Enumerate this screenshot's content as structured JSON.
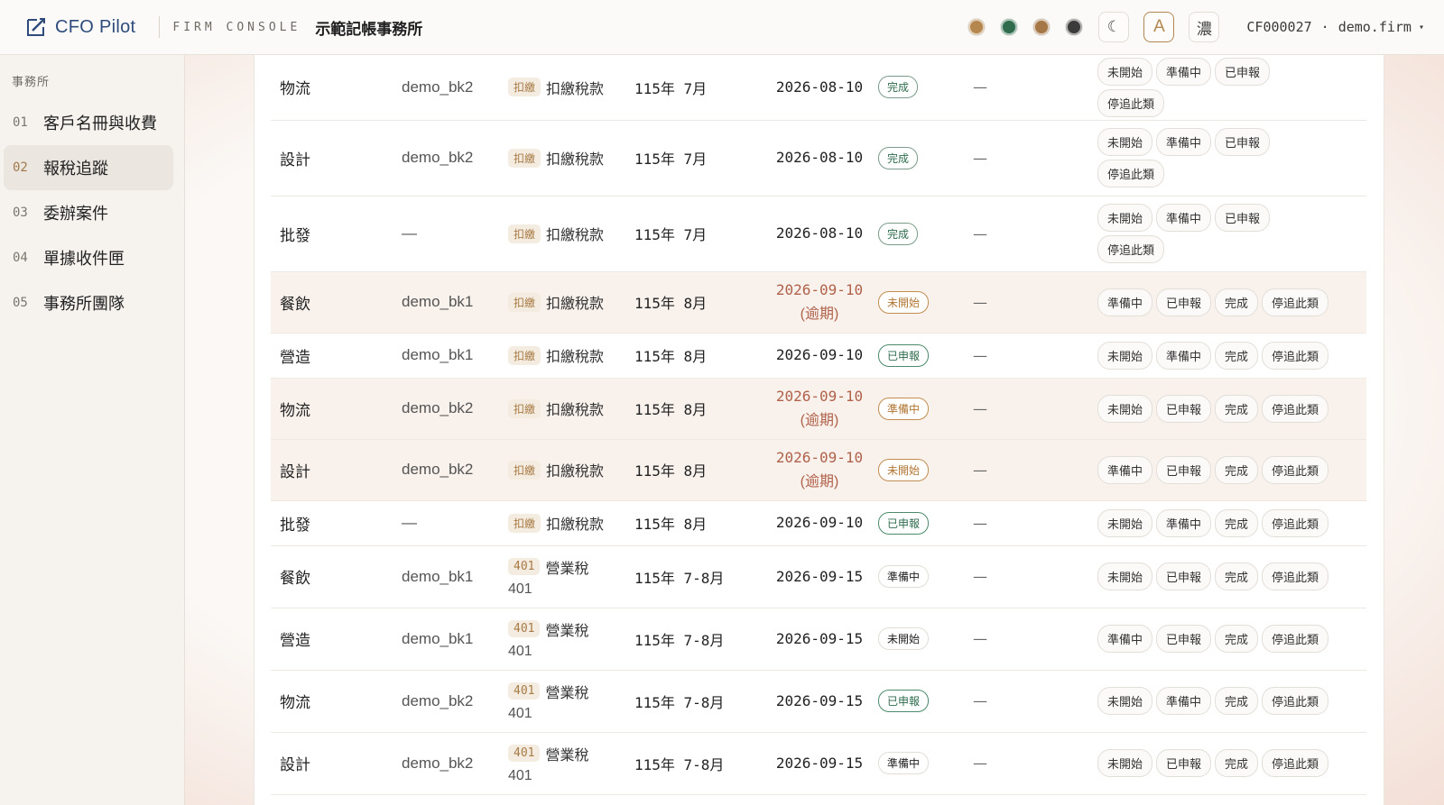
{
  "brand": {
    "name": "CFO Pilot",
    "console_label": "FIRM CONSOLE",
    "firm_name": "示範記帳事務所"
  },
  "theme_swatches": [
    "#b5874f",
    "#2f6b4c",
    "#a57646",
    "#3b3b3b"
  ],
  "toolbar": {
    "dark_toggle": "☾",
    "font_button": "A",
    "density_button": "濃"
  },
  "account": {
    "id": "CF000027",
    "separator": "·",
    "firm": "demo.firm",
    "caret": "▾"
  },
  "sidebar": {
    "title": "事務所",
    "items": [
      {
        "num": "01",
        "label": "客戶名冊與收費"
      },
      {
        "num": "02",
        "label": "報稅追蹤",
        "active": true
      },
      {
        "num": "03",
        "label": "委辦案件"
      },
      {
        "num": "04",
        "label": "單據收件匣"
      },
      {
        "num": "05",
        "label": "事務所團隊"
      }
    ]
  },
  "rows": [
    {
      "industry": "物流",
      "bookkeeper": "demo_bk2",
      "tax_tag": "扣繳",
      "tax_name": "扣繳稅款",
      "tax_code": "",
      "period": "115年 7月",
      "due": "2026-08-10",
      "overdue": false,
      "overdue_label": "",
      "status": "完成",
      "status_style": "done",
      "note": "—",
      "actions": [
        "未開始",
        "準備中",
        "已申報",
        "停追此類"
      ],
      "wrap": true,
      "h": 72
    },
    {
      "industry": "設計",
      "bookkeeper": "demo_bk2",
      "tax_tag": "扣繳",
      "tax_name": "扣繳稅款",
      "tax_code": "",
      "period": "115年 7月",
      "due": "2026-08-10",
      "overdue": false,
      "overdue_label": "",
      "status": "完成",
      "status_style": "done",
      "note": "—",
      "actions": [
        "未開始",
        "準備中",
        "已申報",
        "停追此類"
      ],
      "wrap": true,
      "h": 84
    },
    {
      "industry": "批發",
      "bookkeeper": "—",
      "tax_tag": "扣繳",
      "tax_name": "扣繳稅款",
      "tax_code": "",
      "period": "115年 7月",
      "due": "2026-08-10",
      "overdue": false,
      "overdue_label": "",
      "status": "完成",
      "status_style": "done",
      "note": "—",
      "actions": [
        "未開始",
        "準備中",
        "已申報",
        "停追此類"
      ],
      "wrap": true,
      "h": 84
    },
    {
      "industry": "餐飲",
      "bookkeeper": "demo_bk1",
      "tax_tag": "扣繳",
      "tax_name": "扣繳稅款",
      "tax_code": "",
      "period": "115年 8月",
      "due": "2026-09-10",
      "overdue": true,
      "overdue_label": "(逾期)",
      "status": "未開始",
      "status_style": "warn",
      "note": "—",
      "actions": [
        "準備中",
        "已申報",
        "完成",
        "停追此類"
      ],
      "wrap": false,
      "h": 68
    },
    {
      "industry": "營造",
      "bookkeeper": "demo_bk1",
      "tax_tag": "扣繳",
      "tax_name": "扣繳稅款",
      "tax_code": "",
      "period": "115年 8月",
      "due": "2026-09-10",
      "overdue": false,
      "overdue_label": "",
      "status": "已申報",
      "status_style": "filed",
      "note": "—",
      "actions": [
        "未開始",
        "準備中",
        "完成",
        "停追此類"
      ],
      "wrap": false,
      "h": 50
    },
    {
      "industry": "物流",
      "bookkeeper": "demo_bk2",
      "tax_tag": "扣繳",
      "tax_name": "扣繳稅款",
      "tax_code": "",
      "period": "115年 8月",
      "due": "2026-09-10",
      "overdue": true,
      "overdue_label": "(逾期)",
      "status": "準備中",
      "status_style": "warn",
      "note": "—",
      "actions": [
        "未開始",
        "已申報",
        "完成",
        "停追此類"
      ],
      "wrap": false,
      "h": 68
    },
    {
      "industry": "設計",
      "bookkeeper": "demo_bk2",
      "tax_tag": "扣繳",
      "tax_name": "扣繳稅款",
      "tax_code": "",
      "period": "115年 8月",
      "due": "2026-09-10",
      "overdue": true,
      "overdue_label": "(逾期)",
      "status": "未開始",
      "status_style": "warn",
      "note": "—",
      "actions": [
        "準備中",
        "已申報",
        "完成",
        "停追此類"
      ],
      "wrap": false,
      "h": 68
    },
    {
      "industry": "批發",
      "bookkeeper": "—",
      "tax_tag": "扣繳",
      "tax_name": "扣繳稅款",
      "tax_code": "",
      "period": "115年 8月",
      "due": "2026-09-10",
      "overdue": false,
      "overdue_label": "",
      "status": "已申報",
      "status_style": "filed",
      "note": "—",
      "actions": [
        "未開始",
        "準備中",
        "完成",
        "停追此類"
      ],
      "wrap": false,
      "h": 50
    },
    {
      "industry": "餐飲",
      "bookkeeper": "demo_bk1",
      "tax_tag": "401",
      "tax_name": "營業稅",
      "tax_code": "401",
      "period": "115年 7-8月",
      "due": "2026-09-15",
      "overdue": false,
      "overdue_label": "",
      "status": "準備中",
      "status_style": "plain",
      "note": "—",
      "actions": [
        "未開始",
        "已申報",
        "完成",
        "停追此類"
      ],
      "wrap": false,
      "h": 69
    },
    {
      "industry": "營造",
      "bookkeeper": "demo_bk1",
      "tax_tag": "401",
      "tax_name": "營業稅",
      "tax_code": "401",
      "period": "115年 7-8月",
      "due": "2026-09-15",
      "overdue": false,
      "overdue_label": "",
      "status": "未開始",
      "status_style": "plain",
      "note": "—",
      "actions": [
        "準備中",
        "已申報",
        "完成",
        "停追此類"
      ],
      "wrap": false,
      "h": 69
    },
    {
      "industry": "物流",
      "bookkeeper": "demo_bk2",
      "tax_tag": "401",
      "tax_name": "營業稅",
      "tax_code": "401",
      "period": "115年 7-8月",
      "due": "2026-09-15",
      "overdue": false,
      "overdue_label": "",
      "status": "已申報",
      "status_style": "filed",
      "note": "—",
      "actions": [
        "未開始",
        "準備中",
        "完成",
        "停追此類"
      ],
      "wrap": false,
      "h": 69
    },
    {
      "industry": "設計",
      "bookkeeper": "demo_bk2",
      "tax_tag": "401",
      "tax_name": "營業稅",
      "tax_code": "401",
      "period": "115年 7-8月",
      "due": "2026-09-15",
      "overdue": false,
      "overdue_label": "",
      "status": "準備中",
      "status_style": "plain",
      "note": "—",
      "actions": [
        "未開始",
        "已申報",
        "完成",
        "停追此類"
      ],
      "wrap": false,
      "h": 69
    }
  ]
}
